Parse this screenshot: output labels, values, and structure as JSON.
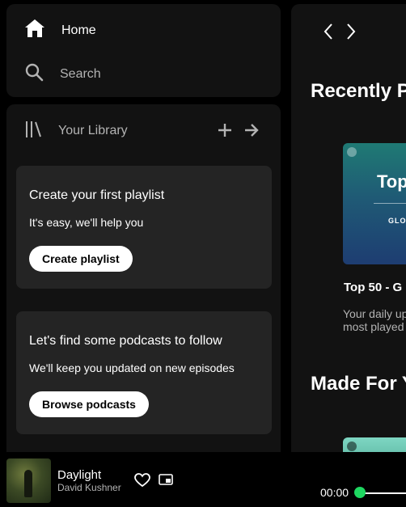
{
  "nav": {
    "home_label": "Home",
    "search_label": "Search"
  },
  "library": {
    "title": "Your Library",
    "cards": [
      {
        "title": "Create your first playlist",
        "subtitle": "It's easy, we'll help you",
        "button": "Create playlist"
      },
      {
        "title": "Let's find some podcasts to follow",
        "subtitle": "We'll keep you updated on new episodes",
        "button": "Browse podcasts"
      }
    ]
  },
  "main": {
    "sections": [
      {
        "title": "Recently P"
      },
      {
        "title": "Made For Y"
      }
    ],
    "playlist": {
      "cover_title": "Top",
      "cover_subtitle": "GLO",
      "title": "Top 50 - G",
      "description": "Your daily up\nmost played"
    }
  },
  "player": {
    "track_title": "Daylight",
    "artist": "David Kushner",
    "time_elapsed": "00:00",
    "progress": 0
  },
  "colors": {
    "accent": "#1ed760",
    "panel_bg": "#121212",
    "card_bg": "#242424",
    "muted_text": "#b3b3b3"
  },
  "icons": [
    "home-icon",
    "search-icon",
    "library-icon",
    "plus-icon",
    "arrow-right-icon",
    "chevron-left-icon",
    "chevron-right-icon",
    "heart-icon",
    "picture-in-picture-icon"
  ]
}
